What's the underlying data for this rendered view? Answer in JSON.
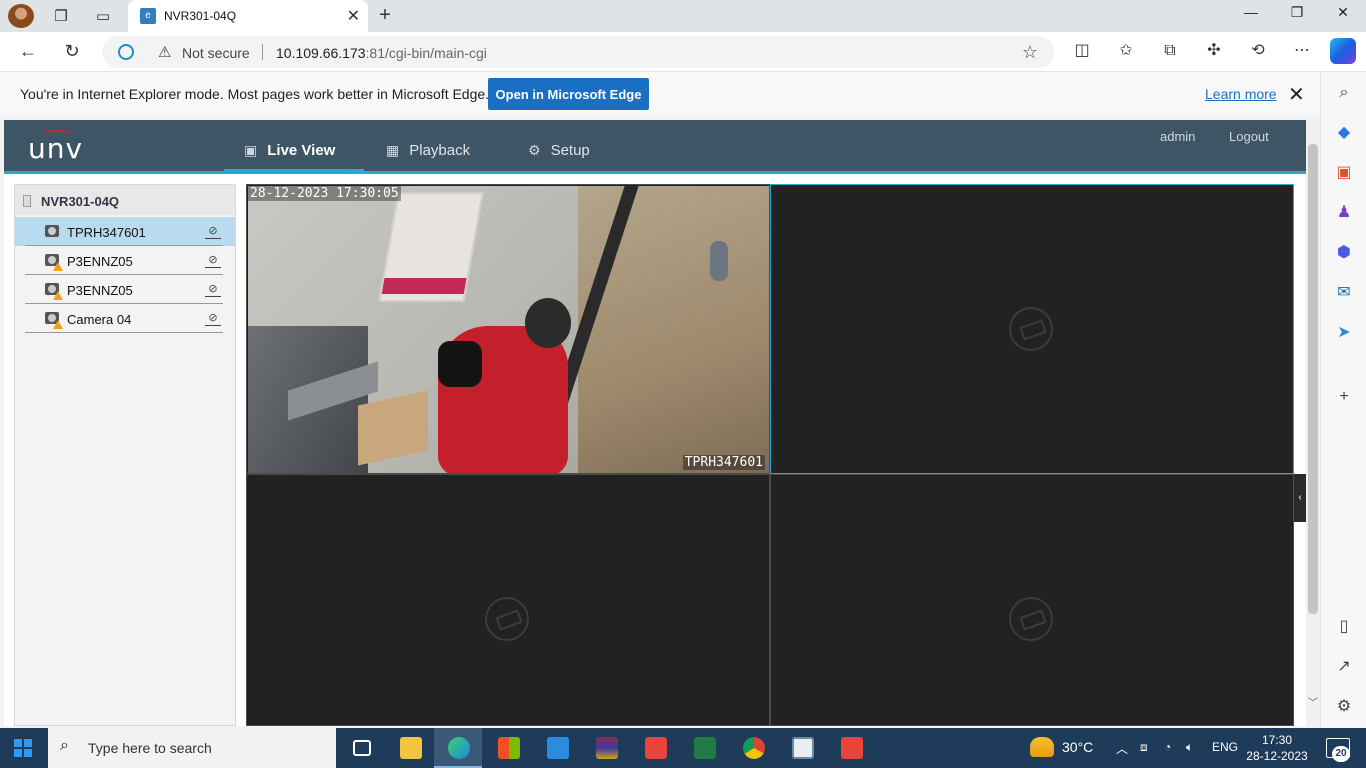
{
  "browser": {
    "tab_title": "NVR301-04Q",
    "new_tab": "+",
    "url_host": "10.109.66.173",
    "url_rest": ":81/cgi-bin/main-cgi",
    "security_label": "Not secure"
  },
  "ie_banner": {
    "message": "You're in Internet Explorer mode. Most pages work better in Microsoft Edge.",
    "open_button": "Open in Microsoft Edge",
    "learn_more": "Learn more"
  },
  "nvr": {
    "logo": "unv",
    "nav": [
      {
        "label": "Live View",
        "icon": "monitor-icon"
      },
      {
        "label": "Playback",
        "icon": "film-icon"
      },
      {
        "label": "Setup",
        "icon": "gear-icon"
      }
    ],
    "user": "admin",
    "logout": "Logout",
    "device": "NVR301-04Q",
    "cameras": [
      {
        "name": "TPRH347601",
        "warning": false
      },
      {
        "name": "P3ENNZ05",
        "warning": true
      },
      {
        "name": "P3ENNZ05",
        "warning": true
      },
      {
        "name": "Camera 04",
        "warning": true
      }
    ],
    "live": {
      "timestamp": "28-12-2023  17:30:05",
      "channel_name": "TPRH347601"
    }
  },
  "taskbar": {
    "search_placeholder": "Type here to search",
    "temperature": "30°C",
    "language": "ENG",
    "time": "17:30",
    "date": "28-12-2023",
    "notifications": "20"
  },
  "colors": {
    "header": "#3e5566",
    "accent": "#2aa7d9",
    "edge_button": "#1a6fc2",
    "taskbar": "#1f3b5a"
  }
}
